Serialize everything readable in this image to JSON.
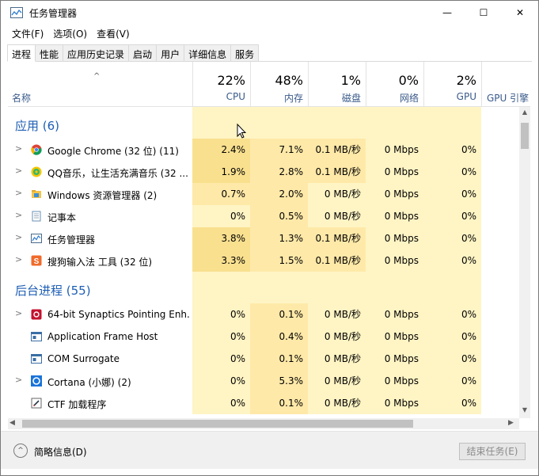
{
  "window": {
    "title": "任务管理器",
    "minimize_glyph": "—",
    "maximize_glyph": "☐",
    "close_glyph": "✕"
  },
  "menu": [
    "文件(F)",
    "选项(O)",
    "查看(V)"
  ],
  "tabs": [
    "进程",
    "性能",
    "应用历史记录",
    "启动",
    "用户",
    "详细信息",
    "服务"
  ],
  "active_tab": "进程",
  "columns": {
    "sort_arrow": "^",
    "name": "名称",
    "cpu": {
      "pct": "22%",
      "label": "CPU"
    },
    "mem": {
      "pct": "48%",
      "label": "内存"
    },
    "disk": {
      "pct": "1%",
      "label": "磁盘"
    },
    "net": {
      "pct": "0%",
      "label": "网络"
    },
    "gpu": {
      "pct": "2%",
      "label": "GPU"
    },
    "gpu_engine": {
      "label": "GPU 引擎"
    }
  },
  "groups": [
    {
      "title": "应用 (6)",
      "rows": [
        {
          "expander": ">",
          "icon": "chrome-icon",
          "name": "Google Chrome (32 位) (11)",
          "cpu": "2.4%",
          "mem": "7.1%",
          "disk": "0.1 MB/秒",
          "net": "0 Mbps",
          "gpu": "0%"
        },
        {
          "expander": ">",
          "icon": "qq-music-icon",
          "name": "QQ音乐，让生活充满音乐 (32 ...",
          "cpu": "1.9%",
          "mem": "2.8%",
          "disk": "0.1 MB/秒",
          "net": "0 Mbps",
          "gpu": "0%"
        },
        {
          "expander": ">",
          "icon": "explorer-icon",
          "name": "Windows 资源管理器 (2)",
          "cpu": "0.7%",
          "mem": "2.0%",
          "disk": "0 MB/秒",
          "net": "0 Mbps",
          "gpu": "0%"
        },
        {
          "expander": ">",
          "icon": "notepad-icon",
          "name": "记事本",
          "cpu": "0%",
          "mem": "0.5%",
          "disk": "0 MB/秒",
          "net": "0 Mbps",
          "gpu": "0%"
        },
        {
          "expander": ">",
          "icon": "task-manager-icon",
          "name": "任务管理器",
          "cpu": "3.8%",
          "mem": "1.3%",
          "disk": "0.1 MB/秒",
          "net": "0 Mbps",
          "gpu": "0%"
        },
        {
          "expander": ">",
          "icon": "sogou-icon",
          "name": "搜狗输入法 工具 (32 位)",
          "cpu": "3.3%",
          "mem": "1.5%",
          "disk": "0.1 MB/秒",
          "net": "0 Mbps",
          "gpu": "0%"
        }
      ]
    },
    {
      "title": "后台进程 (55)",
      "rows": [
        {
          "expander": ">",
          "icon": "synaptics-icon",
          "name": "64-bit Synaptics Pointing Enh...",
          "cpu": "0%",
          "mem": "0.1%",
          "disk": "0 MB/秒",
          "net": "0 Mbps",
          "gpu": "0%"
        },
        {
          "expander": "",
          "icon": "app-frame-icon",
          "name": "Application Frame Host",
          "cpu": "0%",
          "mem": "0.4%",
          "disk": "0 MB/秒",
          "net": "0 Mbps",
          "gpu": "0%"
        },
        {
          "expander": "",
          "icon": "com-surrogate-icon",
          "name": "COM Surrogate",
          "cpu": "0%",
          "mem": "0.1%",
          "disk": "0 MB/秒",
          "net": "0 Mbps",
          "gpu": "0%"
        },
        {
          "expander": ">",
          "icon": "cortana-icon",
          "name": "Cortana (小娜) (2)",
          "cpu": "0%",
          "mem": "5.3%",
          "disk": "0 MB/秒",
          "net": "0 Mbps",
          "gpu": "0%"
        },
        {
          "expander": "",
          "icon": "ctf-icon",
          "name": "CTF 加载程序",
          "cpu": "0%",
          "mem": "0.1%",
          "disk": "0 MB/秒",
          "net": "0 Mbps",
          "gpu": "0%"
        }
      ]
    }
  ],
  "scroll": {
    "up": "▲",
    "down": "▼",
    "left": "◀",
    "right": "▶"
  },
  "footer": {
    "fewer_details_glyph": "^",
    "fewer_details": "简略信息(D)",
    "end_task": "结束任务(E)"
  },
  "colors": {
    "heat_light": "#fff4c4",
    "heat_medium": "#ffe9a8",
    "heat_strong": "#f9e08f",
    "group_title": "#1e5eb5",
    "header_label": "#3a5a8a"
  }
}
